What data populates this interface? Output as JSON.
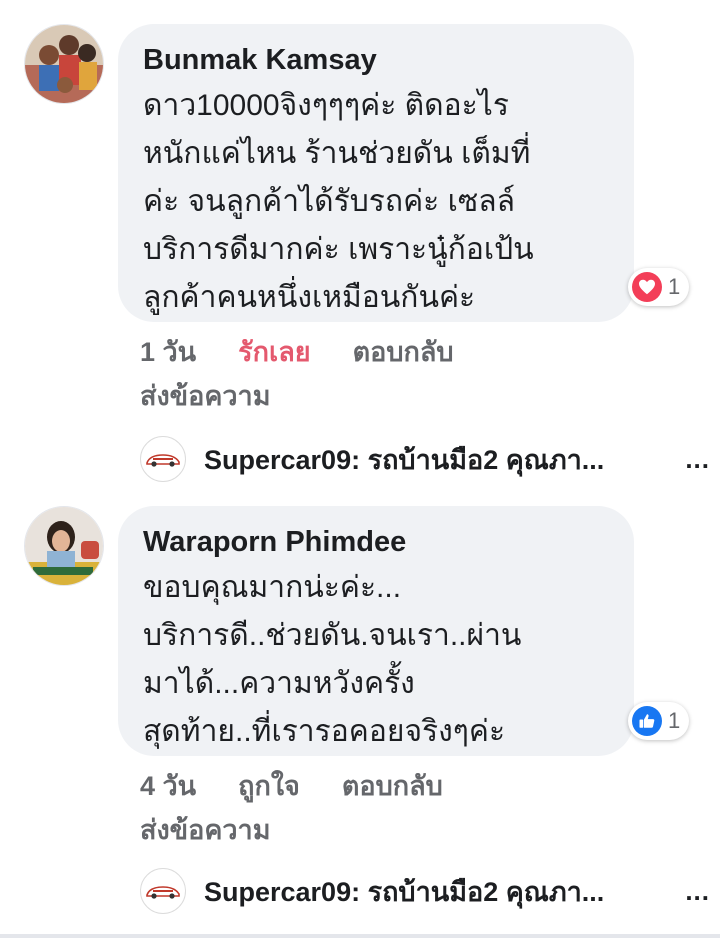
{
  "comments": [
    {
      "author": "Bunmak Kamsay",
      "lines": [
        "ดาว10000จิงๆๆๆค่ะ  ติดอะไร",
        "หนักแค่ไหน  ร้านช่วยดัน เต็มที่",
        "ค่ะ  จนลูกค้าได้รับรถค่ะ  เซลล์",
        "บริการดีมากค่ะ  เพราะนู๋ก้อเป้น",
        "ลูกค้าคนหนึ่งเหมือนกันค่ะ"
      ],
      "reaction": {
        "icon": "heart-icon",
        "count": "1",
        "color": "#f33e58"
      },
      "time": "1 วัน",
      "like_label": "รักเลย",
      "reply_label": "ตอบกลับ",
      "message_label": "ส่งข้อความ",
      "reply_preview": {
        "text": "Supercar09: รถบ้านมือ2 คุณภา...",
        "more": "..."
      }
    },
    {
      "author": "Waraporn Phimdee",
      "lines": [
        "ขอบคุณมากน่ะค่ะ...",
        "บริการดี..ช่วยดัน.จนเรา..ผ่าน",
        "มาได้...ความหวังครั้ง",
        "สุดท้าย..ที่เรารอคอยจริงๆค่ะ"
      ],
      "reaction": {
        "icon": "thumbs-up-icon",
        "count": "1",
        "color": "#1877f2"
      },
      "time": "4 วัน",
      "like_label": "ถูกใจ",
      "reply_label": "ตอบกลับ",
      "message_label": "ส่งข้อความ",
      "reply_preview": {
        "text": "Supercar09: รถบ้านมือ2 คุณภา...",
        "more": "..."
      }
    }
  ],
  "colors": {
    "bubble": "#f0f2f5",
    "meta_text": "#65676b",
    "love_active": "#e4596e"
  }
}
